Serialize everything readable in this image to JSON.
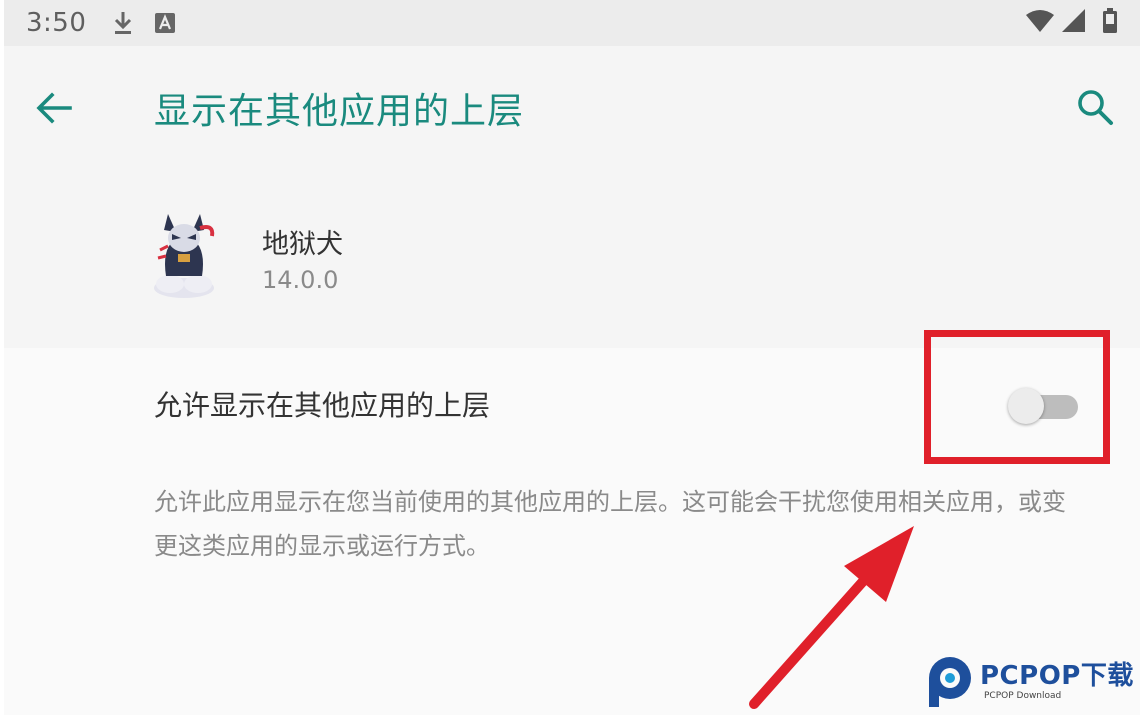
{
  "status_bar": {
    "time": "3:50",
    "icons": [
      "download-icon",
      "font-icon",
      "wifi-icon",
      "signal-icon",
      "battery-icon"
    ]
  },
  "toolbar": {
    "title": "显示在其他应用的上层",
    "back_icon": "arrow-left-icon",
    "search_icon": "search-icon",
    "accent_color": "#1a8a7e"
  },
  "app": {
    "name": "地狱犬",
    "version": "14.0.0"
  },
  "permission": {
    "label": "允许显示在其他应用的上层",
    "enabled": false,
    "description": "允许此应用显示在您当前使用的其他应用的上层。这可能会干扰您使用相关应用，或变更这类应用的显示或运行方式。"
  },
  "annotation": {
    "highlight_color": "#e0202a"
  },
  "watermark": {
    "title": "PCPOP下载",
    "subtitle": "PCPOP Download"
  }
}
